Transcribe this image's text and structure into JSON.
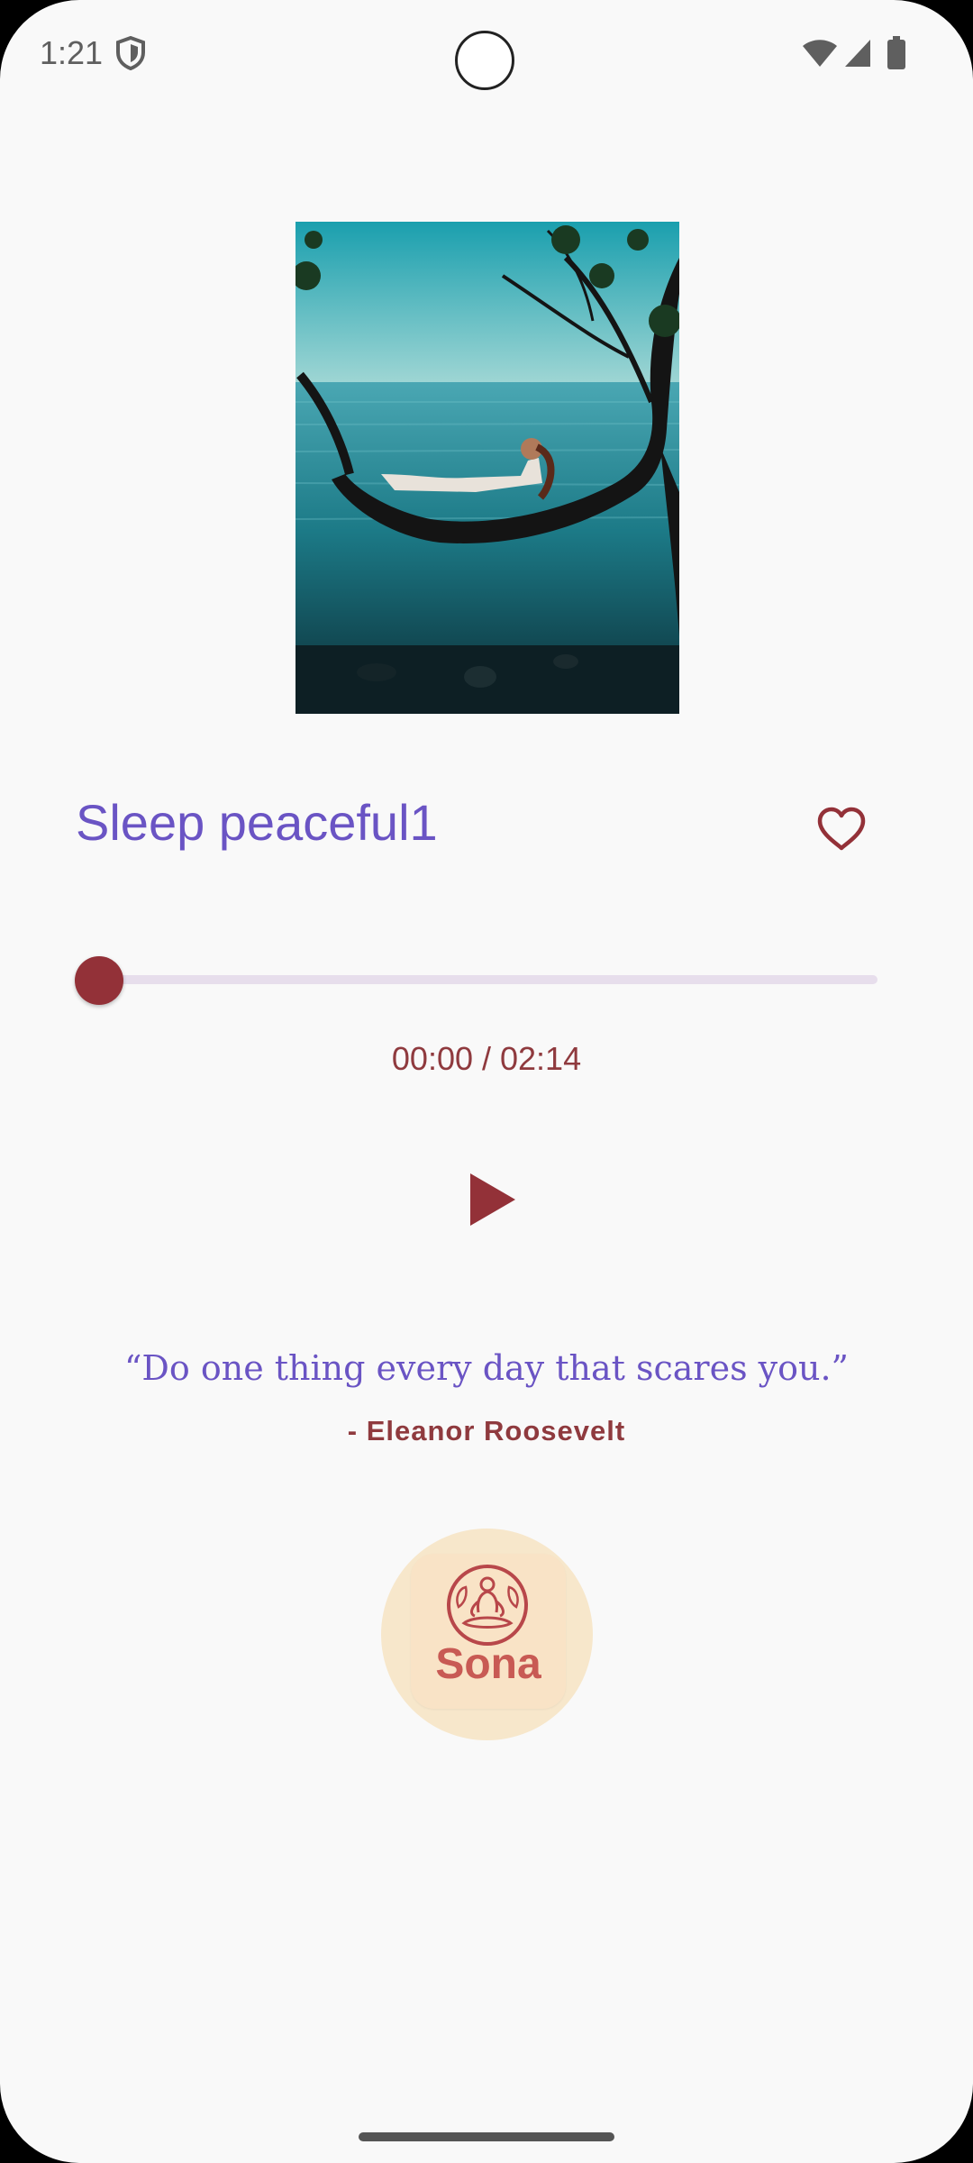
{
  "status_bar": {
    "time": "1:21",
    "icons": [
      "shield-icon",
      "wifi-icon",
      "signal-icon",
      "battery-icon"
    ]
  },
  "player": {
    "cover_image": "woman-on-tree-over-sea",
    "title": "Sleep peaceful1",
    "favorite_icon": "heart-outline-icon",
    "progress": 0,
    "time_readout": "00:00 / 02:14",
    "play_icon": "play-icon"
  },
  "quote": {
    "text": "“Do one thing every day that scares you.”",
    "author": "- Eleanor Roosevelt"
  },
  "logo": {
    "wordmark": "Sona",
    "emblem_icon": "meditation-icon"
  },
  "colors": {
    "background": "#f9f9f9",
    "accent_purple": "#6a54c4",
    "accent_red": "#933138",
    "track": "#e7deec",
    "logo_bg": "#f7e7cb"
  }
}
